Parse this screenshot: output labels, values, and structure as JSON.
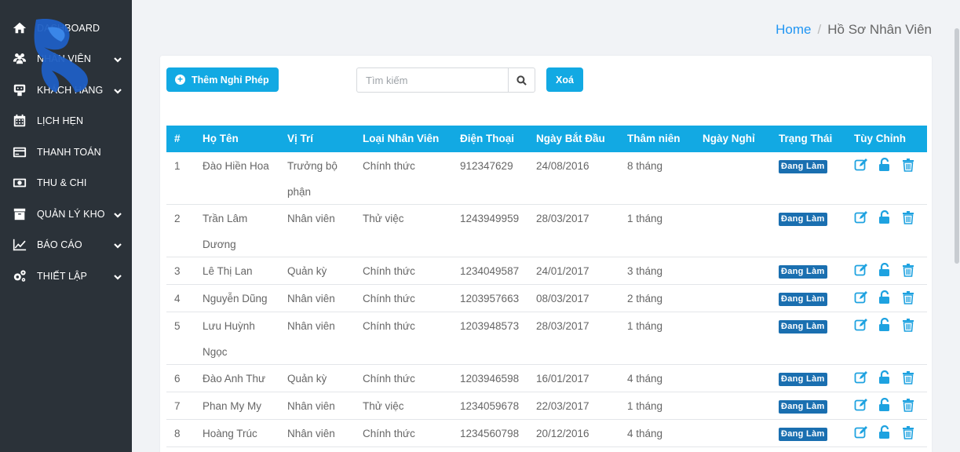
{
  "sidebar": {
    "items": [
      {
        "label": "Dashboard",
        "icon": "home-icon",
        "chevron": false
      },
      {
        "label": "Nhân Viên",
        "icon": "users-icon",
        "chevron": true
      },
      {
        "label": "Khách Hàng",
        "icon": "customer-icon",
        "chevron": true
      },
      {
        "label": "Lịch Hẹn",
        "icon": "calendar-icon",
        "chevron": false
      },
      {
        "label": "Thanh Toán",
        "icon": "credit-card-icon",
        "chevron": false
      },
      {
        "label": "Thu & Chi",
        "icon": "money-icon",
        "chevron": false
      },
      {
        "label": "Quản Lý Kho",
        "icon": "box-icon",
        "chevron": true
      },
      {
        "label": "Báo Cáo",
        "icon": "chart-line-icon",
        "chevron": true
      },
      {
        "label": "Thiết Lập",
        "icon": "gears-icon",
        "chevron": true
      }
    ]
  },
  "breadcrumb": {
    "home": "Home",
    "separator": "/",
    "current": "Hồ Sơ Nhân Viên"
  },
  "toolbar": {
    "add_label": "Thêm Nghỉ Phép",
    "search_placeholder": "Tìm kiếm",
    "clear_label": "Xoá"
  },
  "table": {
    "headers": [
      "#",
      "Họ Tên",
      "Vị Trí",
      "Loại Nhân Viên",
      "Điện Thoại",
      "Ngày Bắt Đầu",
      "Thâm niên",
      "Ngày Nghỉ",
      "Trạng Thái",
      "Tùy Chỉnh"
    ],
    "rows": [
      {
        "no": "1",
        "name": "Đào Hiền Hoa",
        "position": "Trưởng bộ phận",
        "type": "Chính thức",
        "phone": "912347629",
        "start": "24/08/2016",
        "seniority": "8 tháng",
        "leave": "",
        "status": "Đang Làm",
        "tall": true
      },
      {
        "no": "2",
        "name": "Trần Lâm Dương",
        "position": "Nhân viên",
        "type": "Thử việc",
        "phone": "1243949959",
        "start": "28/03/2017",
        "seniority": "1 tháng",
        "leave": "",
        "status": "Đang Làm",
        "tall": true
      },
      {
        "no": "3",
        "name": "Lê Thị Lan",
        "position": "Quản kỳ",
        "type": "Chính thức",
        "phone": "1234049587",
        "start": "24/01/2017",
        "seniority": "3 tháng",
        "leave": "",
        "status": "Đang Làm",
        "tall": false
      },
      {
        "no": "4",
        "name": "Nguyễn Dũng",
        "position": "Nhân viên",
        "type": "Chính thức",
        "phone": "1203957663",
        "start": "08/03/2017",
        "seniority": "2 tháng",
        "leave": "",
        "status": "Đang Làm",
        "tall": false
      },
      {
        "no": "5",
        "name": "Lưu Huỳnh Ngọc",
        "position": "Nhân viên",
        "type": "Chính thức",
        "phone": "1203948573",
        "start": "28/03/2017",
        "seniority": "1 tháng",
        "leave": "",
        "status": "Đang Làm",
        "tall": true
      },
      {
        "no": "6",
        "name": "Đào Anh Thư",
        "position": "Quản kỳ",
        "type": "Chính thức",
        "phone": "1203946598",
        "start": "16/01/2017",
        "seniority": "4 tháng",
        "leave": "",
        "status": "Đang Làm",
        "tall": false
      },
      {
        "no": "7",
        "name": "Phan My My",
        "position": "Nhân viên",
        "type": "Thử việc",
        "phone": "1234059678",
        "start": "22/03/2017",
        "seniority": "1 tháng",
        "leave": "",
        "status": "Đang Làm",
        "tall": false
      },
      {
        "no": "8",
        "name": "Hoàng Trúc",
        "position": "Nhân viên",
        "type": "Chính thức",
        "phone": "1234560798",
        "start": "20/12/2016",
        "seniority": "4 tháng",
        "leave": "",
        "status": "Đang Làm",
        "tall": false
      }
    ]
  },
  "colors": {
    "sidebar_bg": "#2b3239",
    "accent": "#12a9e3",
    "badge": "#1a6fb0",
    "link": "#2196f3"
  }
}
